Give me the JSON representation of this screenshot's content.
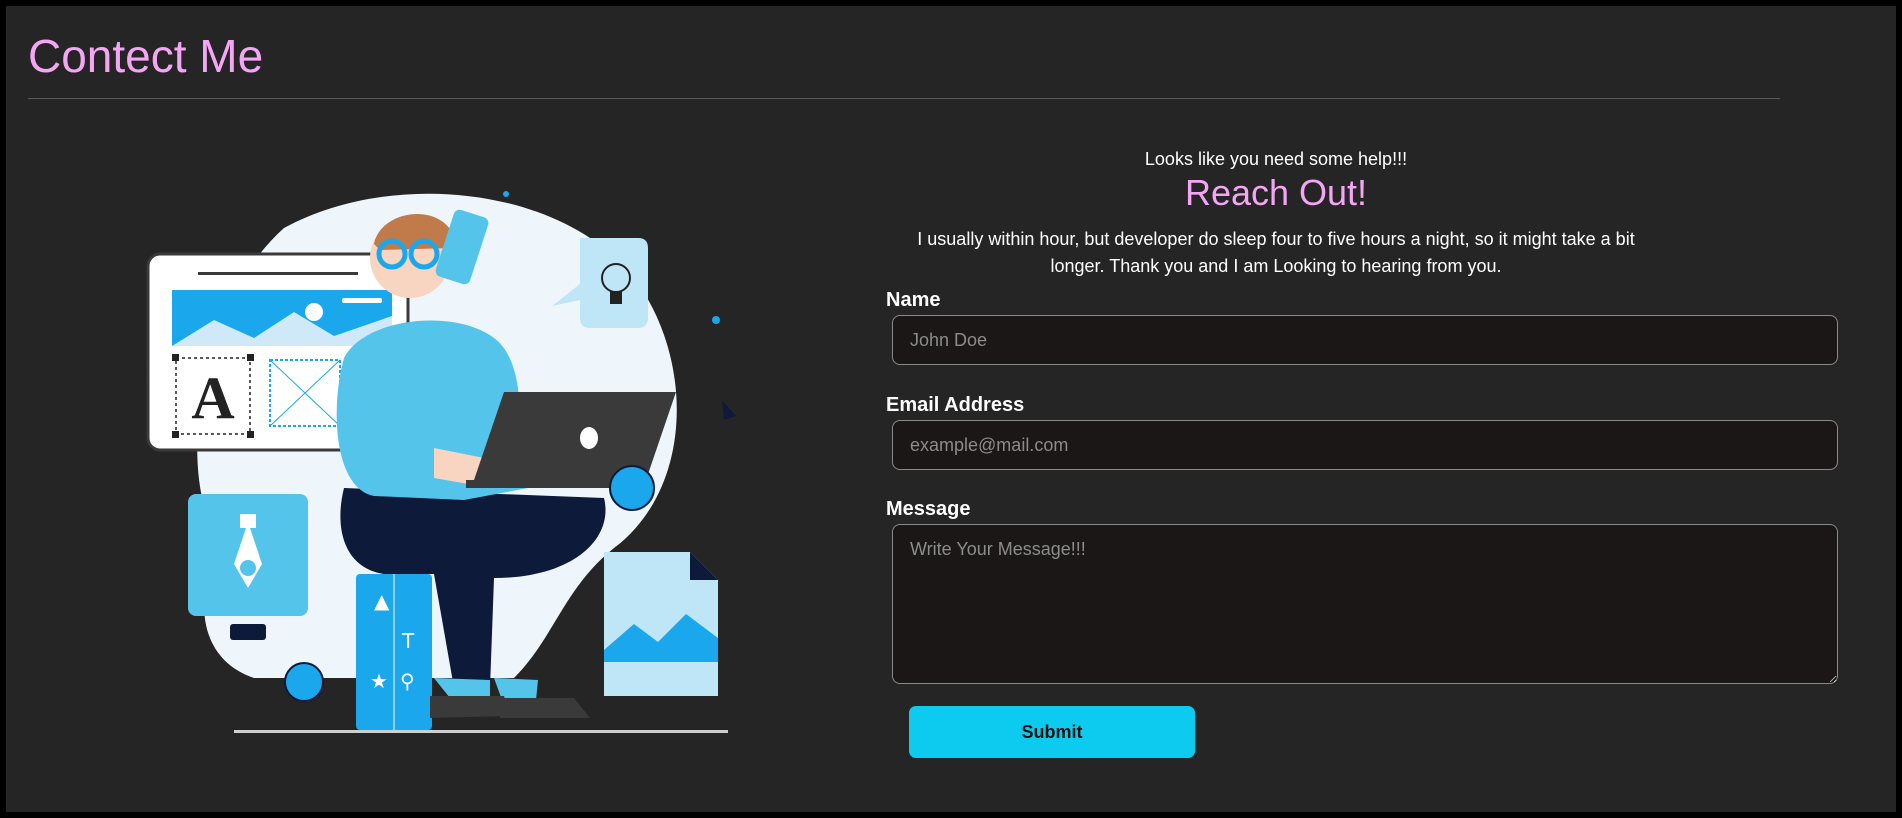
{
  "page": {
    "title": "Contect Me"
  },
  "intro": {
    "tagline": "Looks like you need some help!!!",
    "headline": "Reach Out!",
    "note_line1": "I usually within hour, but developer do sleep four to five hours a night, so it might take a bit",
    "note_line2": "longer. Thank you and I am Looking to hearing from you."
  },
  "form": {
    "name": {
      "label": "Name",
      "value": "",
      "placeholder": "John Doe"
    },
    "email": {
      "label": "Email Address",
      "value": "",
      "placeholder": "example@mail.com"
    },
    "message": {
      "label": "Message",
      "value": "",
      "placeholder": "Write Your Message!!!"
    },
    "submit_label": "Submit"
  },
  "illustration": {
    "icon_name": "designer-on-phone-illustration",
    "letter_tile": "A",
    "colors": {
      "accent_blue": "#1aa7ec",
      "light_blue": "#55c4ea",
      "pale_blue": "#eef6fb",
      "navy": "#0d1a3a"
    }
  },
  "colors": {
    "background": "#252525",
    "title": "#f4a6f4",
    "field_background": "#1b1716",
    "button": "#0dcbee"
  }
}
